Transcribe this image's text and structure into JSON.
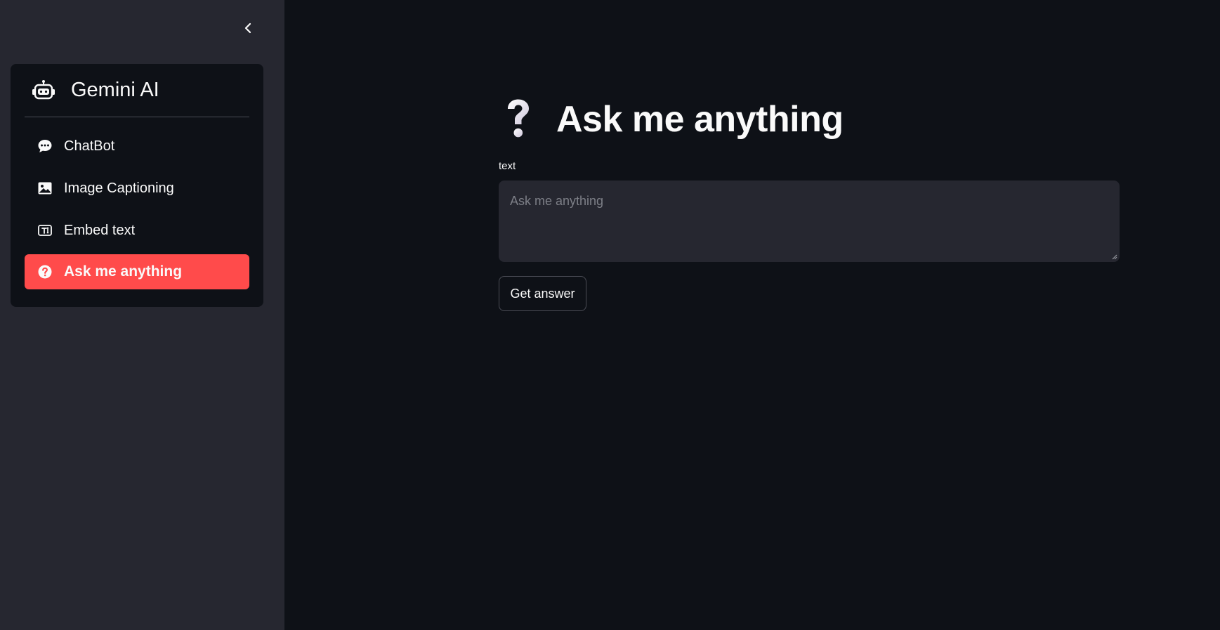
{
  "sidebar": {
    "brand": "Gemini AI",
    "brand_icon": "robot-icon",
    "items": [
      {
        "label": "ChatBot",
        "icon": "chat-bubble-icon",
        "active": false
      },
      {
        "label": "Image Captioning",
        "icon": "image-icon",
        "active": false
      },
      {
        "label": "Embed text",
        "icon": "text-embed-icon",
        "active": false
      },
      {
        "label": "Ask me anything",
        "icon": "question-circle-icon",
        "active": true
      }
    ],
    "collapse_icon": "chevron-left-icon"
  },
  "main": {
    "title": "Ask me anything",
    "title_icon": "question-mark-icon",
    "field_label": "text",
    "input_value": "",
    "input_placeholder": "Ask me anything",
    "button_label": "Get answer"
  },
  "colors": {
    "app_background": "#0e1117",
    "sidebar_background": "#262730",
    "accent": "#ff4b4b",
    "text": "#fafafa",
    "input_background": "#262730",
    "placeholder": "#7d7f87"
  }
}
